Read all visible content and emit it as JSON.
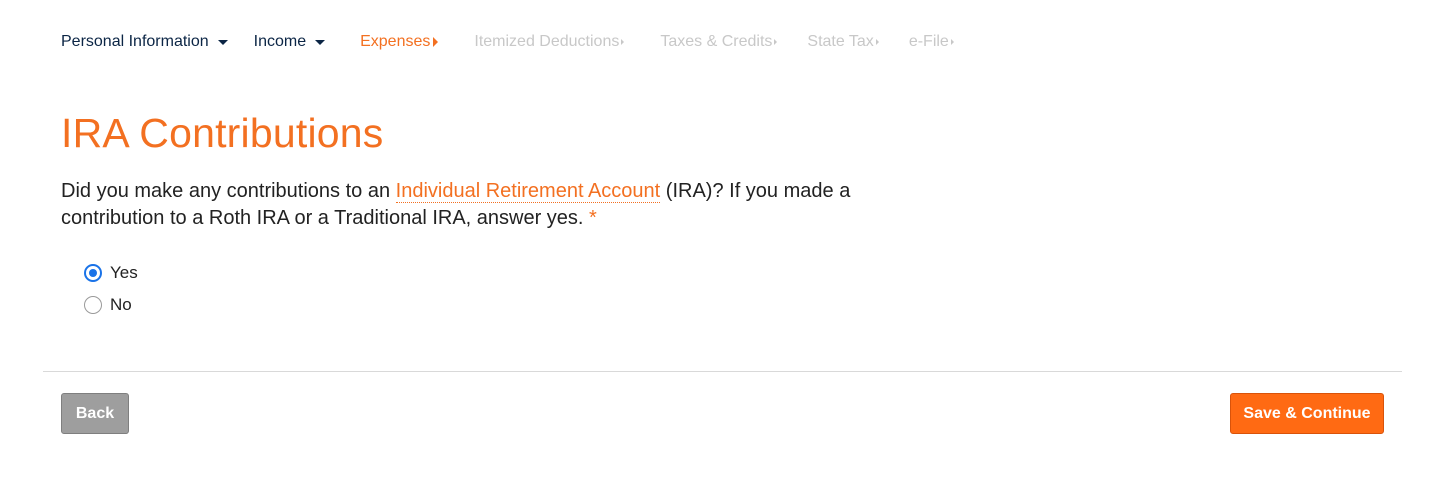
{
  "nav": {
    "items": [
      {
        "label": "Personal Information",
        "state": "done"
      },
      {
        "label": "Income",
        "state": "done"
      },
      {
        "label": "Expenses",
        "state": "current"
      },
      {
        "label": "Itemized Deductions",
        "state": "future"
      },
      {
        "label": "Taxes & Credits",
        "state": "future"
      },
      {
        "label": "State Tax",
        "state": "future"
      },
      {
        "label": "e-File",
        "state": "future"
      }
    ]
  },
  "page": {
    "title": "IRA Contributions",
    "question_before": "Did you make any contributions to an ",
    "question_link": "Individual Retirement Account",
    "question_after": " (IRA)? If you made a contribution to a Roth IRA or a Traditional IRA, answer yes. ",
    "required_mark": "*"
  },
  "options": [
    {
      "label": "Yes",
      "selected": true
    },
    {
      "label": "No",
      "selected": false
    }
  ],
  "buttons": {
    "back_label": "Back",
    "save_label": "Save & Continue"
  },
  "colors": {
    "accent": "#f37021",
    "nav_done": "#0b2545",
    "nav_future": "#c8c8c8",
    "radio_selected": "#1a73e8",
    "save_button": "#ff6a13",
    "back_button": "#9e9e9e"
  }
}
